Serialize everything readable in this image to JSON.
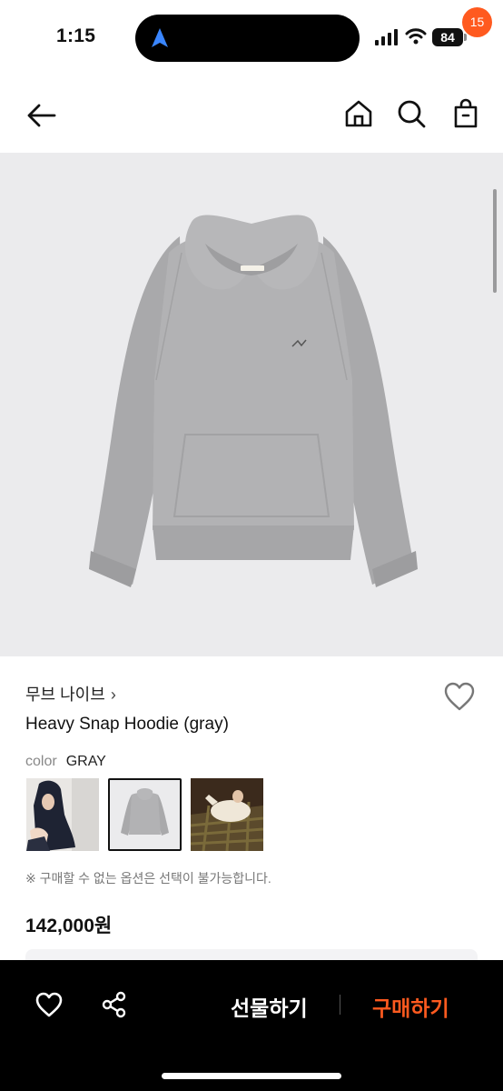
{
  "status_bar": {
    "time": "1:15",
    "battery": "84"
  },
  "header": {
    "cart_count": "15"
  },
  "product": {
    "brand": "무브 나이브",
    "brand_chevron": "›",
    "name": "Heavy Snap Hoodie (gray)",
    "color_label": "color",
    "color_value": "GRAY",
    "notice": "※ 구매할 수 없는 옵션은 선택이 불가능합니다.",
    "price": "142,000원"
  },
  "thumbnails": [
    {
      "id": "model-navy",
      "selected": false
    },
    {
      "id": "gray-hoodie",
      "selected": true
    },
    {
      "id": "model-lounging",
      "selected": false
    }
  ],
  "bottom_bar": {
    "gift_label": "선물하기",
    "buy_label": "구매하기"
  },
  "colors": {
    "accent": "#ff5a1f",
    "image_bg": "#ebebed",
    "bar_bg": "#000000"
  },
  "icons": [
    "back-arrow-icon",
    "home-icon",
    "search-icon",
    "shopping-bag-icon",
    "heart-icon",
    "share-icon",
    "navigation-arrow-icon",
    "signal-icon",
    "wifi-icon",
    "battery-icon"
  ]
}
